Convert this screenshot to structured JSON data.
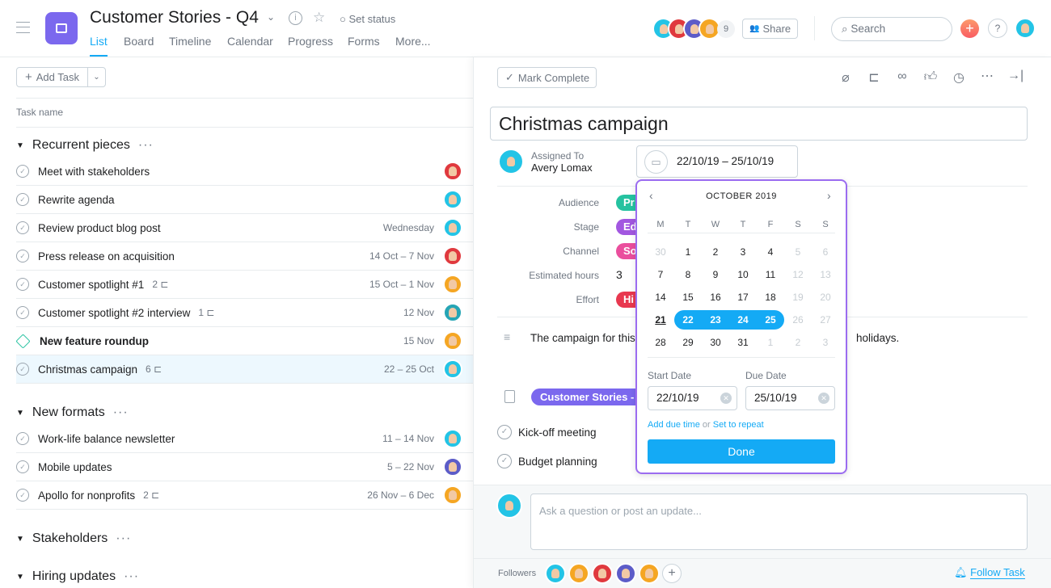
{
  "header": {
    "title": "Customer Stories - Q4",
    "set_status": "Set status",
    "tabs": [
      "List",
      "Board",
      "Timeline",
      "Calendar",
      "Progress",
      "Forms",
      "More..."
    ],
    "member_count": "9",
    "share": "Share",
    "search_placeholder": "Search"
  },
  "colors": {
    "accent": "#14aaf5",
    "project": "#7b68ee",
    "popup_border": "#9b6cf0"
  },
  "left": {
    "add_task": "Add Task",
    "column": "Task name",
    "sections": [
      {
        "name": "Recurrent pieces",
        "tasks": [
          {
            "name": "Meet with stakeholders",
            "sub": "",
            "date": "",
            "av": "#e0393e"
          },
          {
            "name": "Rewrite agenda",
            "sub": "",
            "date": "",
            "av": "#23c4e6"
          },
          {
            "name": "Review product blog post",
            "sub": "",
            "date": "Wednesday",
            "av": "#23c4e6"
          },
          {
            "name": "Press release on acquisition",
            "sub": "",
            "date": "14 Oct – 7 Nov",
            "av": "#e0393e"
          },
          {
            "name": "Customer spotlight #1",
            "sub": "2",
            "date": "15 Oct – 1 Nov",
            "av": "#f5a623"
          },
          {
            "name": "Customer spotlight #2 interview",
            "sub": "1",
            "date": "12 Nov",
            "av": "#26a5b5"
          },
          {
            "name": "New feature roundup",
            "sub": "",
            "date": "15 Nov",
            "av": "#f5a623",
            "milestone": true
          },
          {
            "name": "Christmas campaign",
            "sub": "6",
            "date": "22 – 25 Oct",
            "av": "#23c4e6",
            "selected": true
          }
        ]
      },
      {
        "name": "New formats",
        "tasks": [
          {
            "name": "Work-life balance newsletter",
            "sub": "",
            "date": "11 – 14 Nov",
            "av": "#23c4e6"
          },
          {
            "name": "Mobile updates",
            "sub": "",
            "date": "5 – 22 Nov",
            "av": "#5c5cc8"
          },
          {
            "name": "Apollo for nonprofits",
            "sub": "2",
            "date": "26 Nov – 6 Dec",
            "av": "#f5a623"
          }
        ]
      },
      {
        "name": "Stakeholders",
        "tasks": []
      },
      {
        "name": "Hiring updates",
        "tasks": []
      }
    ]
  },
  "detail": {
    "mark_complete": "Mark Complete",
    "title": "Christmas campaign",
    "assigned_label": "Assigned To",
    "assignee": "Avery Lomax",
    "date_range": "22/10/19 – 25/10/19",
    "fields": [
      {
        "label": "Audience",
        "value": "Pr",
        "color": "#25c2a0"
      },
      {
        "label": "Stage",
        "value": "Ed",
        "color": "#a257e0"
      },
      {
        "label": "Channel",
        "value": "So",
        "color": "#ea4e9d"
      },
      {
        "label": "Estimated hours",
        "value": "3"
      },
      {
        "label": "Effort",
        "value": "Hi",
        "color": "#e8384f"
      }
    ],
    "description": "The campaign for this",
    "description_end": "holidays.",
    "project": "Customer Stories - Q",
    "subtasks": [
      "Kick-off meeting",
      "Budget planning"
    ],
    "comment_placeholder": "Ask a question or post an update...",
    "followers_label": "Followers",
    "follow": "Follow Task"
  },
  "calendar": {
    "month": "OCTOBER 2019",
    "weekdays": [
      "M",
      "T",
      "W",
      "T",
      "F",
      "S",
      "S"
    ],
    "weeks": [
      [
        30,
        1,
        2,
        3,
        4,
        5,
        6
      ],
      [
        7,
        8,
        9,
        10,
        11,
        12,
        13
      ],
      [
        14,
        15,
        16,
        17,
        18,
        19,
        20
      ],
      [
        21,
        22,
        23,
        24,
        25,
        26,
        27
      ],
      [
        28,
        29,
        30,
        31,
        1,
        2,
        3
      ]
    ],
    "muted": [
      [
        0,
        0
      ],
      [
        0,
        5
      ],
      [
        0,
        6
      ],
      [
        1,
        5
      ],
      [
        1,
        6
      ],
      [
        2,
        5
      ],
      [
        2,
        6
      ],
      [
        3,
        5
      ],
      [
        3,
        6
      ],
      [
        4,
        4
      ],
      [
        4,
        5
      ],
      [
        4,
        6
      ]
    ],
    "today": [
      3,
      0
    ],
    "selected_start": 22,
    "selected_end": 25,
    "start_label": "Start Date",
    "due_label": "Due Date",
    "start": "22/10/19",
    "due": "25/10/19",
    "add_time": "Add due time",
    "or": "or",
    "repeat": "Set to repeat",
    "done": "Done"
  }
}
